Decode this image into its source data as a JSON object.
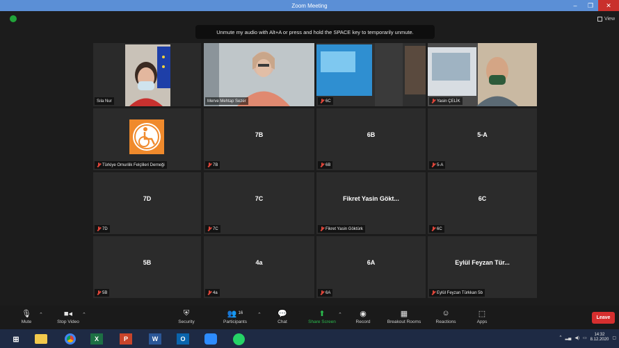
{
  "window": {
    "title": "Zoom Meeting",
    "min": "–",
    "max": "❐",
    "close": "✕"
  },
  "view": {
    "label": "View"
  },
  "notice": "Unmute my audio with Alt+A or press and hold the SPACE key to temporarily unmute.",
  "tiles": [
    {
      "label": "Sıla Nur",
      "big": ""
    },
    {
      "label": "Merve Mehtap Sezer",
      "big": ""
    },
    {
      "label": "6C",
      "big": ""
    },
    {
      "label": "Yasin ÇELİK",
      "big": ""
    },
    {
      "label": "Türkiye Omurilik Felçlileri Derneği",
      "big": ""
    },
    {
      "label": "7B",
      "big": "7B"
    },
    {
      "label": "6B",
      "big": "6B"
    },
    {
      "label": "5-A",
      "big": "5-A"
    },
    {
      "label": "7D",
      "big": "7D"
    },
    {
      "label": "7C",
      "big": "7C"
    },
    {
      "label": "Fikret Yasin Göktürk",
      "big": "Fikret Yasin Gökt..."
    },
    {
      "label": "6C",
      "big": "6C"
    },
    {
      "label": "5B",
      "big": "5B"
    },
    {
      "label": "4a",
      "big": "4a"
    },
    {
      "label": "6A",
      "big": "6A"
    },
    {
      "label": "Eylül Feyzan Türkkan 5b",
      "big": "Eylül Feyzan Tür..."
    }
  ],
  "toolbar": {
    "mute": "Mute",
    "video": "Stop Video",
    "security": "Security",
    "participants": "Participants",
    "participants_count": "16",
    "chat": "Chat",
    "share": "Share Screen",
    "record": "Record",
    "breakout": "Breakout Rooms",
    "reactions": "Reactions",
    "apps": "Apps",
    "leave": "Leave"
  },
  "taskbar": {
    "clock_time": "14:32",
    "clock_date": "8.12.2020"
  },
  "colors": {
    "active_speaker": "#d9e64a",
    "leave": "#d62f2f",
    "share": "#2bbd4e"
  }
}
